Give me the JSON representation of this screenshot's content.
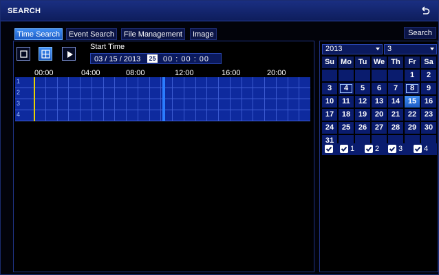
{
  "window": {
    "title": "SEARCH"
  },
  "tabs": [
    "Time Search",
    "Event Search",
    "File Management",
    "Image"
  ],
  "search_button": "Search",
  "start_time": {
    "label": "Start Time",
    "date": "03 / 15 / 2013",
    "cursor_text": "25",
    "time": "00 : 00 : 00"
  },
  "timeline": {
    "hour_labels": [
      "00:00",
      "04:00",
      "08:00",
      "12:00",
      "16:00",
      "20:00"
    ],
    "channels": [
      "1",
      "2",
      "3",
      "4"
    ]
  },
  "calendar": {
    "year": "2013",
    "month": "3",
    "weekdays": [
      "Su",
      "Mo",
      "Tu",
      "We",
      "Th",
      "Fr",
      "Sa"
    ],
    "weeks": [
      [
        "",
        "",
        "",
        "",
        "",
        "1",
        "2"
      ],
      [
        "3",
        "4",
        "5",
        "6",
        "7",
        "8",
        "9"
      ],
      [
        "10",
        "11",
        "12",
        "13",
        "14",
        "15",
        "16"
      ],
      [
        "17",
        "18",
        "19",
        "20",
        "21",
        "22",
        "23"
      ],
      [
        "24",
        "25",
        "26",
        "27",
        "28",
        "29",
        "30"
      ],
      [
        "31",
        "",
        "",
        "",
        "",
        "",
        ""
      ]
    ],
    "selected_day": "15",
    "record_days": [
      "4",
      "8"
    ]
  },
  "channel_checks": [
    "",
    "1",
    "2",
    "3",
    "4"
  ],
  "colors": {
    "accent": "#2a7cff",
    "timeline": "#0e2a9e",
    "titlebar": "#1a2f82",
    "cursor": "#e8d200"
  }
}
